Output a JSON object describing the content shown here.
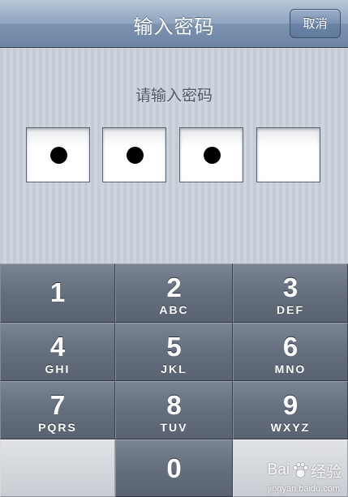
{
  "navbar": {
    "title": "输入密码",
    "cancel_label": "取消"
  },
  "pin_entry": {
    "prompt": "请输入密码",
    "boxes": [
      {
        "filled": true
      },
      {
        "filled": true
      },
      {
        "filled": true
      },
      {
        "filled": false
      }
    ]
  },
  "keypad": {
    "keys": [
      {
        "digit": "1",
        "letters": ""
      },
      {
        "digit": "2",
        "letters": "ABC"
      },
      {
        "digit": "3",
        "letters": "DEF"
      },
      {
        "digit": "4",
        "letters": "GHI"
      },
      {
        "digit": "5",
        "letters": "JKL"
      },
      {
        "digit": "6",
        "letters": "MNO"
      },
      {
        "digit": "7",
        "letters": "PQRS"
      },
      {
        "digit": "8",
        "letters": "TUV"
      },
      {
        "digit": "9",
        "letters": "WXYZ"
      },
      {
        "digit": "0",
        "letters": ""
      }
    ]
  },
  "watermark": {
    "brand": "Bai",
    "brand_suffix": "经验",
    "url": "jingyan.baidu.com"
  },
  "colors": {
    "navbar": "#7d93b0",
    "panel": "#c9cfd8",
    "key": "#656e7d",
    "dot": "#000000"
  }
}
